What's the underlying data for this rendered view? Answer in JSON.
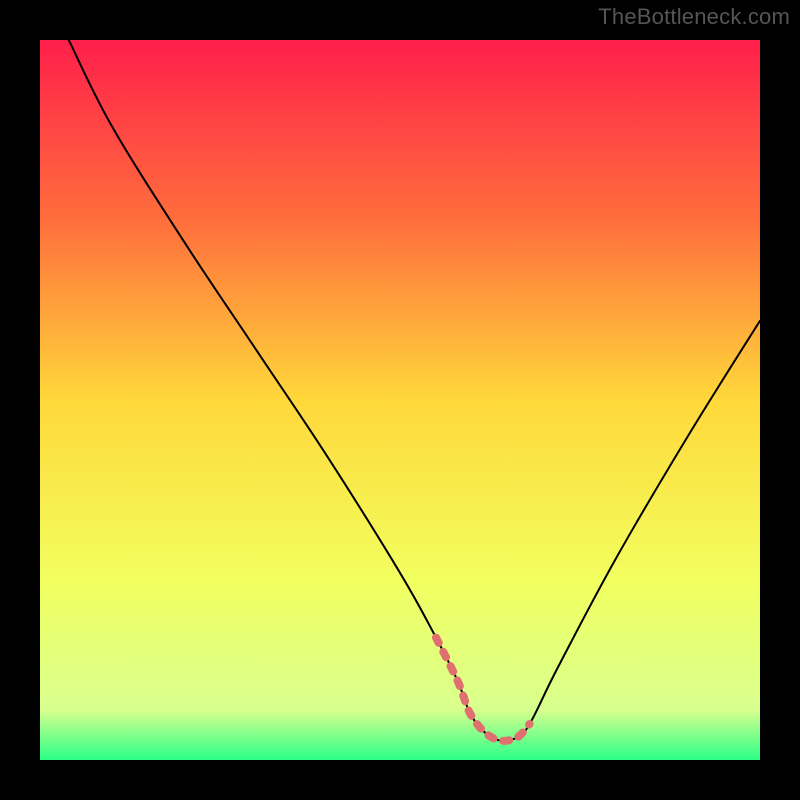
{
  "attribution": "TheBottleneck.com",
  "chart_data": {
    "type": "line",
    "title": "",
    "xlabel": "",
    "ylabel": "",
    "xlim": [
      0,
      100
    ],
    "ylim": [
      0,
      100
    ],
    "grid": false,
    "legend": false,
    "gradient_stops": [
      {
        "offset": 0,
        "color": "#ff1f4b"
      },
      {
        "offset": 25,
        "color": "#ff6e3c"
      },
      {
        "offset": 50,
        "color": "#ffd83a"
      },
      {
        "offset": 75,
        "color": "#f2ff5f"
      },
      {
        "offset": 93,
        "color": "#d8ff8e"
      },
      {
        "offset": 100,
        "color": "#2bff88"
      }
    ],
    "series": [
      {
        "name": "bottleneck-curve",
        "stroke": "#000000",
        "stroke_width": 2,
        "x": [
          4,
          10,
          20,
          30,
          40,
          50,
          55,
          58,
          60,
          63,
          66,
          68,
          72,
          80,
          90,
          100
        ],
        "values": [
          100,
          88,
          72,
          57,
          42,
          26,
          17,
          11,
          6,
          3,
          3,
          5,
          13,
          28,
          45,
          61
        ]
      },
      {
        "name": "flat-zone-marker",
        "stroke": "#e06f6f",
        "stroke_width": 8,
        "dash": "6 10",
        "x": [
          55,
          58,
          60,
          63,
          66,
          68
        ],
        "values": [
          17,
          11,
          6,
          3,
          3,
          5
        ]
      }
    ]
  }
}
